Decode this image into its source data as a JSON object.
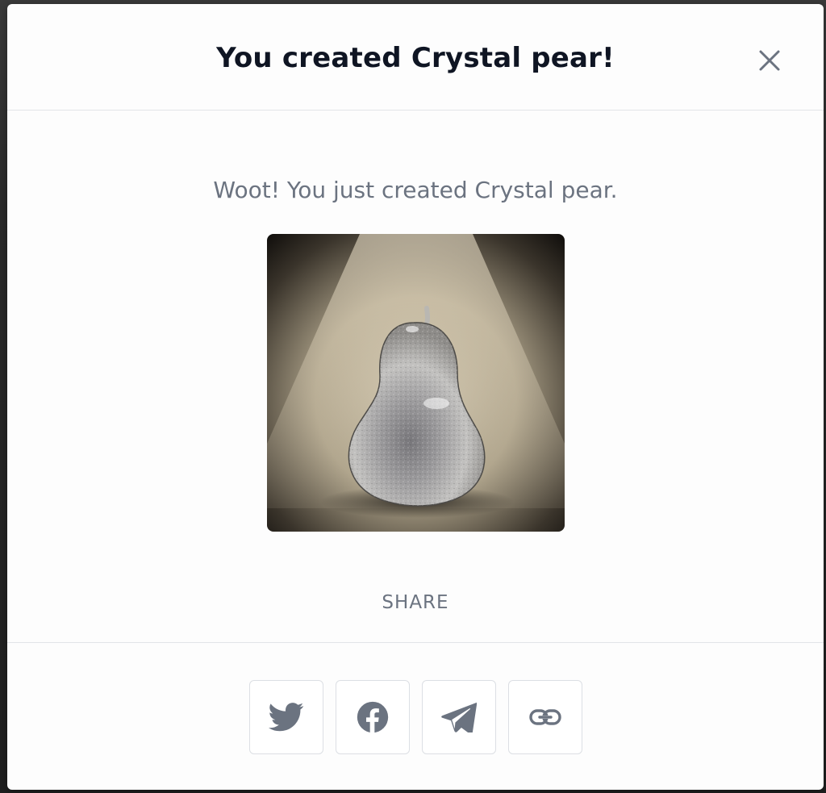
{
  "modal": {
    "title": "You created Crystal pear!",
    "close_icon": "close-icon",
    "message": "Woot! You just created Crystal pear.",
    "image_alt": "Crystal pear",
    "share_label": "SHARE",
    "share_buttons": [
      {
        "name": "twitter",
        "icon": "twitter-icon"
      },
      {
        "name": "facebook",
        "icon": "facebook-icon"
      },
      {
        "name": "telegram",
        "icon": "telegram-icon"
      },
      {
        "name": "copy-link",
        "icon": "link-icon"
      }
    ]
  },
  "colors": {
    "title": "#0f1523",
    "muted_text": "#6b7380",
    "icon": "#6b7380",
    "border": "#e2e4e8",
    "modal_bg": "#fdfdfd"
  }
}
